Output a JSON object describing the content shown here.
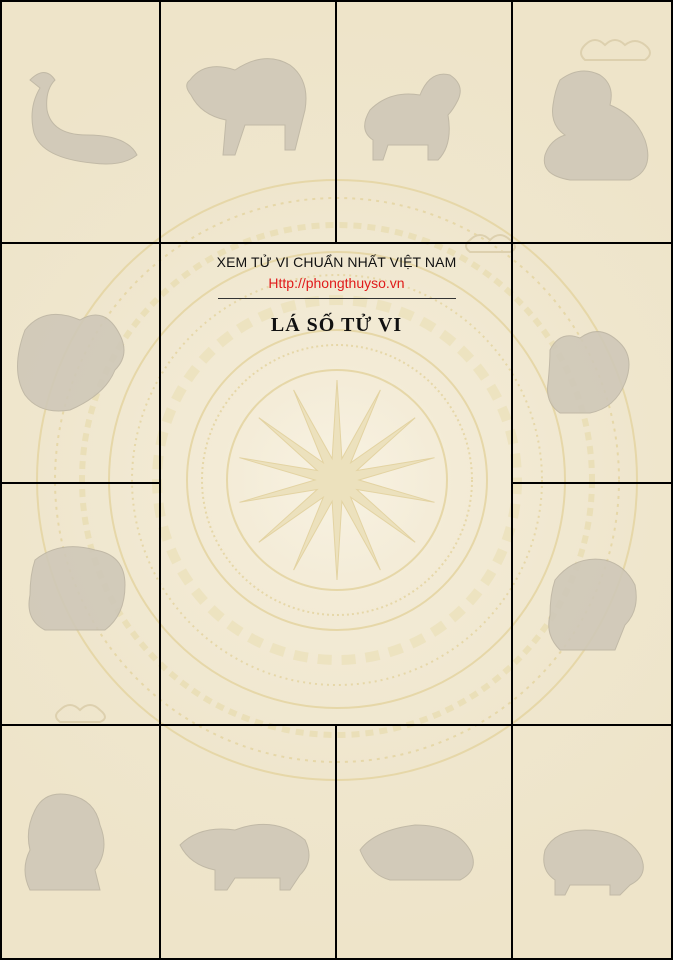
{
  "header": {
    "subtitle": "XEM TỬ VI CHUẨN NHẤT VIỆT NAM",
    "url": "Http://phongthuyso.vn",
    "title": "LÁ SỐ TỬ VI"
  },
  "palaces": [
    {
      "zodiac": "snake-icon"
    },
    {
      "zodiac": "horse-icon"
    },
    {
      "zodiac": "goat-icon"
    },
    {
      "zodiac": "monkey-icon"
    },
    {
      "zodiac": "dragon-icon"
    },
    {
      "zodiac": "rooster-icon"
    },
    {
      "zodiac": "cat-icon"
    },
    {
      "zodiac": "dog-icon"
    },
    {
      "zodiac": "tiger-icon"
    },
    {
      "zodiac": "buffalo-icon"
    },
    {
      "zodiac": "rat-icon"
    },
    {
      "zodiac": "pig-icon"
    }
  ],
  "colors": {
    "grid_line": "#000000",
    "paper": "#f3ecda",
    "url_red": "#e01b1b",
    "ornament": "#e6d7a8",
    "animal": "#c9c2b2"
  }
}
